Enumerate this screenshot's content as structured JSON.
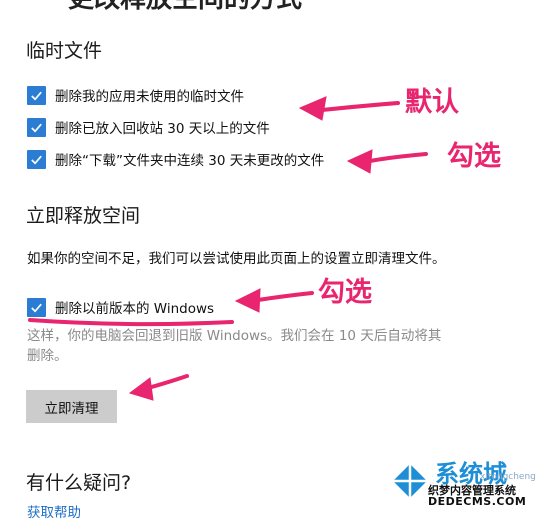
{
  "page": {
    "title_cut": "更改释放空间的方式"
  },
  "temp_files": {
    "heading": "临时文件",
    "items": [
      {
        "label": "删除我的应用未使用的临时文件",
        "checked": true
      },
      {
        "label": "删除已放入回收站 30 天以上的文件",
        "checked": true
      },
      {
        "label": "删除“下载”文件夹中连续 30 天未更改的文件",
        "checked": true
      }
    ]
  },
  "free_now": {
    "heading": "立即释放空间",
    "description": "如果你的空间不足，我们可以尝试使用此页面上的设置立即清理文件。",
    "option": {
      "label": "删除以前版本的 Windows",
      "checked": true
    },
    "option_note_line1": "这样，你的电脑会回退到旧版 Windows。我们会在 10 天后自动将其",
    "option_note_line2": "删除。",
    "button_label": "立即清理"
  },
  "help": {
    "heading": "有什么疑问?",
    "link": "获取帮助"
  },
  "annotations": {
    "default_note": "默认",
    "check_note_1": "勾选",
    "check_note_2": "勾选",
    "color": "#e8256e"
  },
  "watermark": {
    "brand": "系统城",
    "site_line1": "织梦内容管理系统",
    "site_line2": "DEDECMS.COM",
    "url": "xitongcheng.com"
  },
  "colors": {
    "checkbox": "#2b7cd3",
    "button": "#cccccc",
    "link": "#1f6fc7"
  }
}
